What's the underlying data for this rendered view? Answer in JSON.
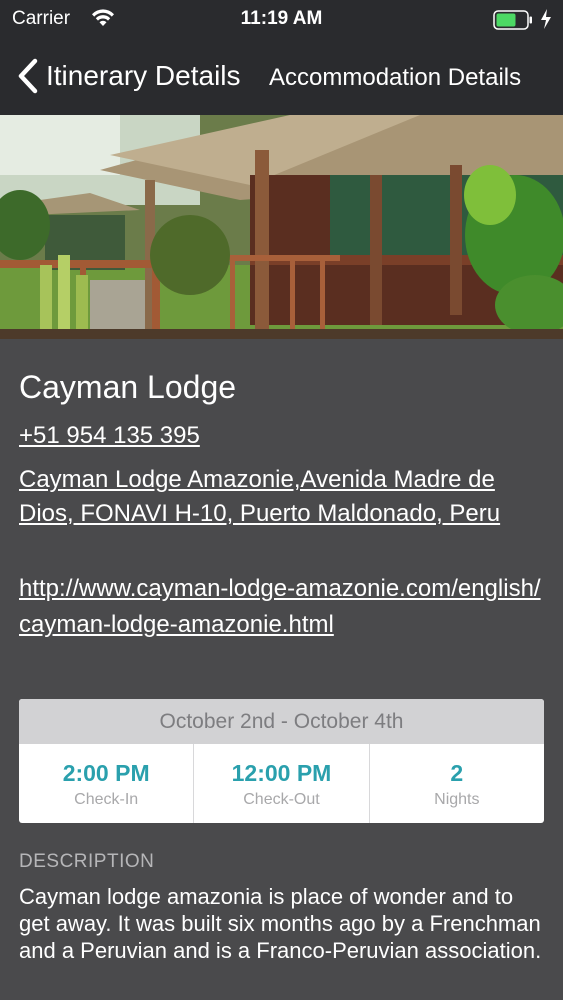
{
  "status_bar": {
    "carrier": "Carrier",
    "time": "11:19 AM",
    "battery_color": "#4cd964"
  },
  "nav": {
    "back_label": "Itinerary Details",
    "title": "Accommodation Details"
  },
  "lodge": {
    "name": "Cayman Lodge",
    "phone": "+51 954 135 395",
    "address": "Cayman Lodge Amazonie,Avenida Madre de Dios, FONAVI H-10, Puerto Maldonado, Peru",
    "website": "http://www.cayman-lodge-amazonie.com/english/cayman-lodge-amazonie.html"
  },
  "stay": {
    "dates": "October 2nd - October 4th",
    "check_in_time": "2:00 PM",
    "check_in_label": "Check-In",
    "check_out_time": "12:00 PM",
    "check_out_label": "Check-Out",
    "nights": "2",
    "nights_label": "Nights"
  },
  "description": {
    "heading": "DESCRIPTION",
    "text": "Cayman lodge amazonia is place of wonder and to get away. It was built six months ago by a Frenchman and a Peruvian and is a Franco-Peruvian association."
  },
  "colors": {
    "accent": "#2aa0ad",
    "bar_background": "#2a2b2e",
    "content_background": "#4a4a4c"
  }
}
